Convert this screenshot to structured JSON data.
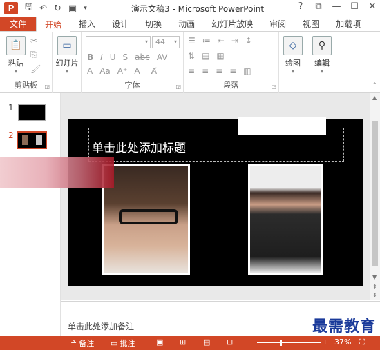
{
  "window": {
    "title": "演示文稿3 - Microsoft PowerPoint",
    "app_icon_letter": "P",
    "controls": [
      "?",
      "⧉",
      "—",
      "☐",
      "✕"
    ]
  },
  "qat": {
    "icons": [
      "save-icon",
      "undo-icon",
      "redo-icon",
      "start-from-beginning-icon",
      "customize-qat-icon"
    ]
  },
  "ribbon_tabs": [
    {
      "label": "文件"
    },
    {
      "label": "开始"
    },
    {
      "label": "插入"
    },
    {
      "label": "设计"
    },
    {
      "label": "切换"
    },
    {
      "label": "动画"
    },
    {
      "label": "幻灯片放映"
    },
    {
      "label": "审阅"
    },
    {
      "label": "视图"
    },
    {
      "label": "加载项"
    }
  ],
  "ribbon": {
    "clipboard": {
      "paste_label": "粘贴",
      "group_label": "剪贴板"
    },
    "slides": {
      "new_slide_label": "幻灯片"
    },
    "font": {
      "group_label": "字体",
      "size_value": "44"
    },
    "paragraph": {
      "group_label": "段落"
    },
    "drawing": {
      "label": "绘图"
    },
    "editing": {
      "label": "编辑"
    }
  },
  "thumbnails": [
    {
      "number": "1"
    },
    {
      "number": "2",
      "selected": true
    }
  ],
  "slide": {
    "title_placeholder": "单击此处添加标题"
  },
  "notes": {
    "placeholder": "单击此处添加备注",
    "watermark": "最需教育"
  },
  "status": {
    "notes_label": "备注",
    "comments_label": "批注",
    "zoom_minus": "−",
    "zoom_plus": "+",
    "zoom_value": "37%",
    "zoom_fraction": 0.37
  },
  "colors": {
    "accent": "#d24726",
    "slide_bg": "#000000"
  }
}
